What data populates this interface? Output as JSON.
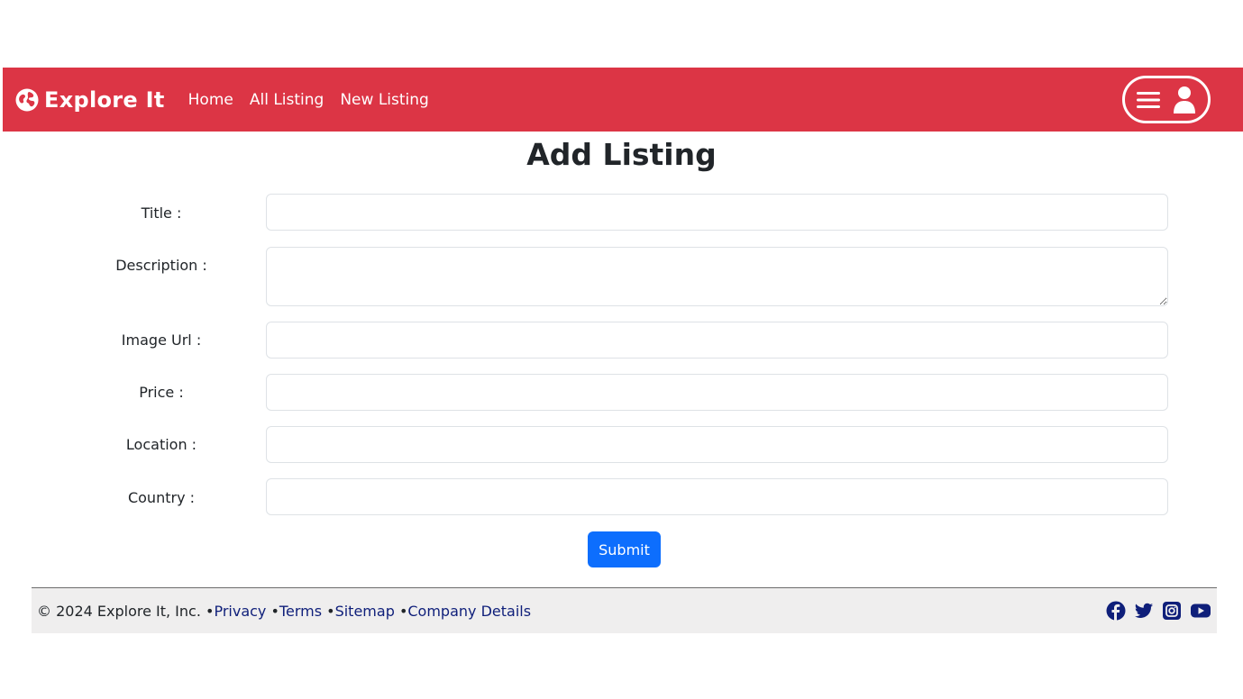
{
  "navbar": {
    "brand": "Explore It",
    "links": [
      "Home",
      "All Listing",
      "New Listing"
    ],
    "brand_color": "#dc3545"
  },
  "form": {
    "title": "Add Listing",
    "fields": [
      {
        "label": "Title :",
        "value": ""
      },
      {
        "label": "Description :",
        "value": ""
      },
      {
        "label": "Image Url :",
        "value": ""
      },
      {
        "label": "Price :",
        "value": ""
      },
      {
        "label": "Location :",
        "value": ""
      },
      {
        "label": "Country :",
        "value": ""
      }
    ],
    "submit_label": "Submit",
    "submit_color": "#0d6efd"
  },
  "footer": {
    "copyright": "© 2024 Explore It, Inc. ",
    "links": [
      "Privacy",
      "Terms",
      "Sitemap",
      "Company Details"
    ],
    "separator": "•",
    "social_icons": [
      "facebook-icon",
      "twitter-icon",
      "instagram-icon",
      "youtube-icon"
    ]
  }
}
